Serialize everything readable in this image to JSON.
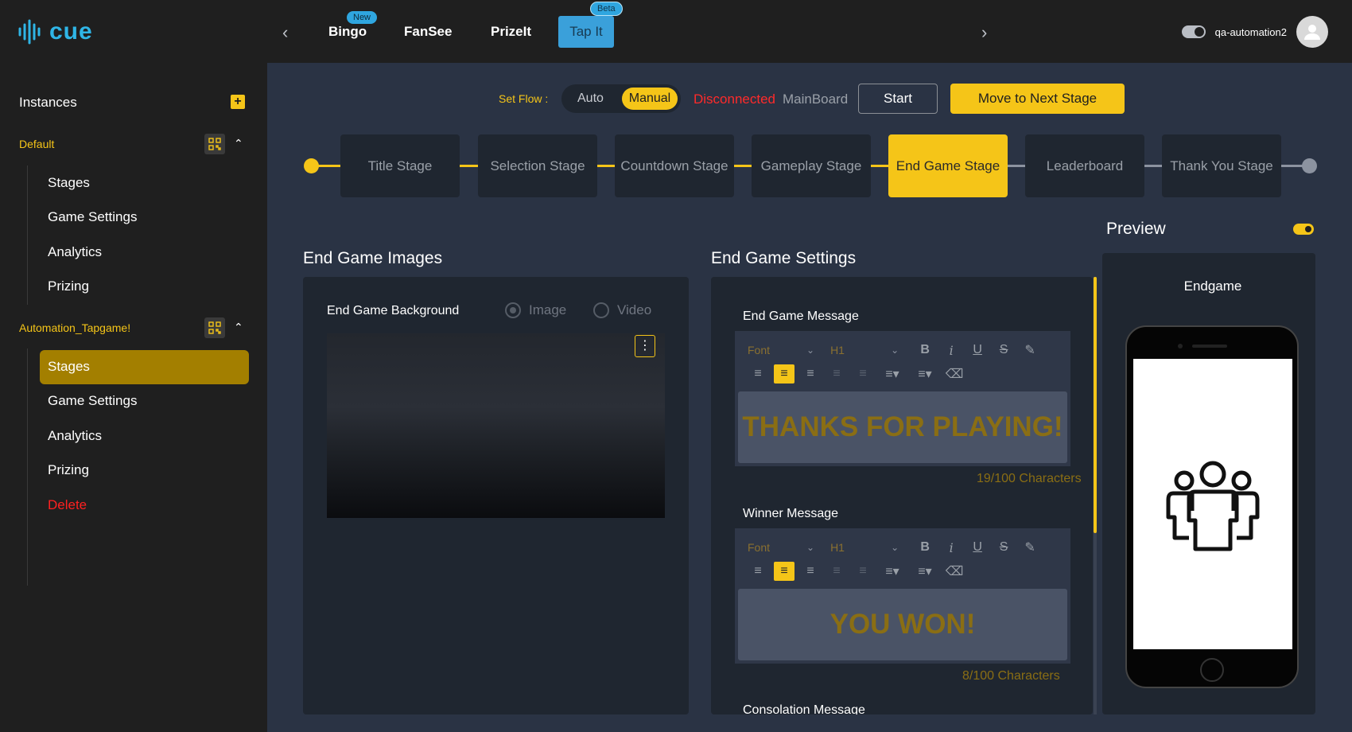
{
  "brand": {
    "logo_text": "cue"
  },
  "nav": {
    "items": [
      {
        "label": "Bingo",
        "badge": "New"
      },
      {
        "label": "FanSee"
      },
      {
        "label": "PrizeIt"
      },
      {
        "label": "Tap It",
        "badge": "Beta"
      }
    ]
  },
  "user": {
    "name": "qa-automation2"
  },
  "sidebar": {
    "title": "Instances",
    "groups": [
      {
        "name": "Default",
        "items": [
          "Stages",
          "Game Settings",
          "Analytics",
          "Prizing"
        ]
      },
      {
        "name": "Automation_Tapgame!",
        "items": [
          "Stages",
          "Game Settings",
          "Analytics",
          "Prizing",
          "Delete"
        ],
        "active_item": "Stages"
      }
    ]
  },
  "flow": {
    "label": "Set Flow :",
    "options": [
      "Auto",
      "Manual"
    ],
    "selected": "Manual",
    "status": "Disconnected",
    "board": "MainBoard",
    "start_label": "Start",
    "next_label": "Move to Next Stage"
  },
  "stages": {
    "items": [
      "Title Stage",
      "Selection Stage",
      "Countdown Stage",
      "Gameplay Stage",
      "End Game Stage",
      "Leaderboard",
      "Thank You Stage"
    ],
    "active": "End Game Stage"
  },
  "images": {
    "title": "End Game Images",
    "background_label": "End Game Background",
    "media_options": [
      "Image",
      "Video"
    ],
    "selected_media": "Image"
  },
  "settings": {
    "title": "End Game Settings",
    "toolbar": {
      "font_label": "Font",
      "heading_label": "H1"
    },
    "fields": [
      {
        "label": "End Game Message",
        "value": "THANKS FOR PLAYING!",
        "count": "19/100 Characters"
      },
      {
        "label": "Winner Message",
        "value": "YOU WON!",
        "count": "8/100 Characters"
      },
      {
        "label": "Consolation Message"
      }
    ]
  },
  "preview": {
    "title": "Preview",
    "screen_name": "Endgame",
    "enabled": true
  },
  "colors": {
    "accent": "#f5c518",
    "info": "#2fa6e0",
    "error": "#ff2a2a"
  }
}
